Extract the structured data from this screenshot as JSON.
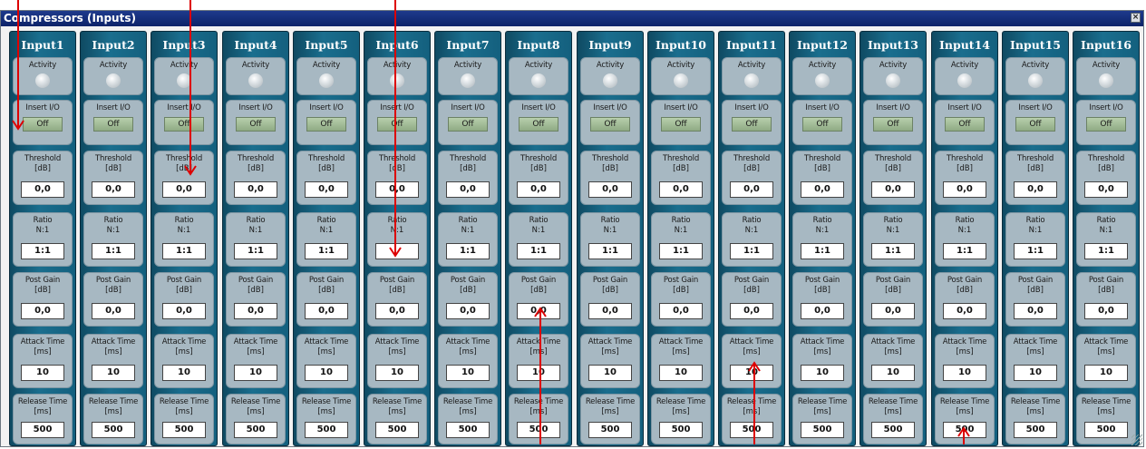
{
  "window": {
    "title": "Compressors (Inputs)",
    "close_icon": "close-icon"
  },
  "labels": {
    "activity": "Activity",
    "insert": "Insert I/O",
    "threshold": "Threshold",
    "threshold_unit": "[dB]",
    "ratio": "Ratio",
    "ratio_unit": "N:1",
    "post_gain": "Post Gain",
    "post_gain_unit": "[dB]",
    "attack": "Attack Time",
    "attack_unit": "[ms]",
    "release": "Release Time",
    "release_unit": "[ms]"
  },
  "channels": [
    {
      "name": "Input1",
      "insert": "Off",
      "threshold": "0,0",
      "ratio": "1:1",
      "post_gain": "0,0",
      "attack": "10",
      "release": "500"
    },
    {
      "name": "Input2",
      "insert": "Off",
      "threshold": "0,0",
      "ratio": "1:1",
      "post_gain": "0,0",
      "attack": "10",
      "release": "500"
    },
    {
      "name": "Input3",
      "insert": "Off",
      "threshold": "0,0",
      "ratio": "1:1",
      "post_gain": "0,0",
      "attack": "10",
      "release": "500"
    },
    {
      "name": "Input4",
      "insert": "Off",
      "threshold": "0,0",
      "ratio": "1:1",
      "post_gain": "0,0",
      "attack": "10",
      "release": "500"
    },
    {
      "name": "Input5",
      "insert": "Off",
      "threshold": "0,0",
      "ratio": "1:1",
      "post_gain": "0,0",
      "attack": "10",
      "release": "500"
    },
    {
      "name": "Input6",
      "insert": "Off",
      "threshold": "0,0",
      "ratio": "",
      "post_gain": "0,0",
      "attack": "10",
      "release": "500"
    },
    {
      "name": "Input7",
      "insert": "Off",
      "threshold": "0,0",
      "ratio": "1:1",
      "post_gain": "0,0",
      "attack": "10",
      "release": "500"
    },
    {
      "name": "Input8",
      "insert": "Off",
      "threshold": "0,0",
      "ratio": "1:1",
      "post_gain": "0,0",
      "attack": "10",
      "release": "500"
    },
    {
      "name": "Input9",
      "insert": "Off",
      "threshold": "0,0",
      "ratio": "1:1",
      "post_gain": "0,0",
      "attack": "10",
      "release": "500"
    },
    {
      "name": "Input10",
      "insert": "Off",
      "threshold": "0,0",
      "ratio": "1:1",
      "post_gain": "0,0",
      "attack": "10",
      "release": "500"
    },
    {
      "name": "Input11",
      "insert": "Off",
      "threshold": "0,0",
      "ratio": "1:1",
      "post_gain": "0,0",
      "attack": "10",
      "release": "500"
    },
    {
      "name": "Input12",
      "insert": "Off",
      "threshold": "0,0",
      "ratio": "1:1",
      "post_gain": "0,0",
      "attack": "10",
      "release": "500"
    },
    {
      "name": "Input13",
      "insert": "Off",
      "threshold": "0,0",
      "ratio": "1:1",
      "post_gain": "0,0",
      "attack": "10",
      "release": "500"
    },
    {
      "name": "Input14",
      "insert": "Off",
      "threshold": "0,0",
      "ratio": "1:1",
      "post_gain": "0,0",
      "attack": "10",
      "release": "500"
    },
    {
      "name": "Input15",
      "insert": "Off",
      "threshold": "0,0",
      "ratio": "1:1",
      "post_gain": "0,0",
      "attack": "10",
      "release": "500"
    },
    {
      "name": "Input16",
      "insert": "Off",
      "threshold": "0,0",
      "ratio": "1:1",
      "post_gain": "0,0",
      "attack": "10",
      "release": "500"
    }
  ],
  "colors": {
    "annotation_arrow": "#dd0000",
    "title_bar": "#0c2369",
    "channel_strip": "#1a6e8e"
  }
}
